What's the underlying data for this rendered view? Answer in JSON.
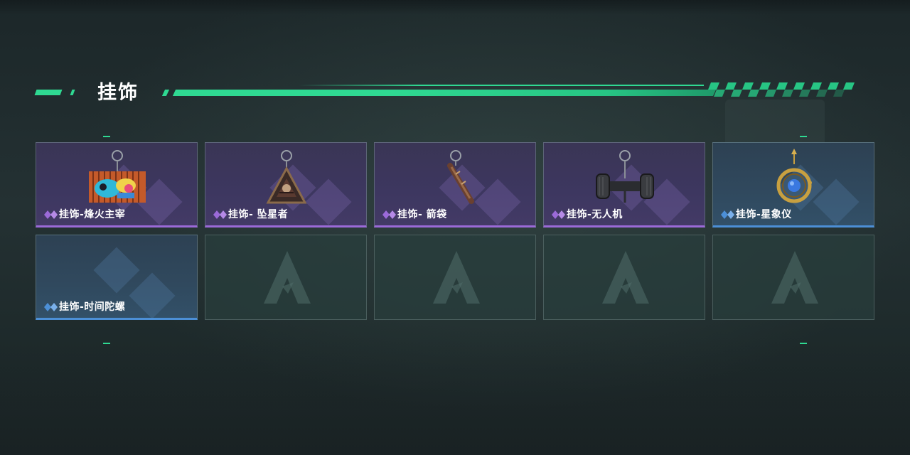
{
  "header": {
    "title": "挂饰"
  },
  "colors": {
    "accent_green": "#2fd992",
    "rarity_epic": "#9b6ad8",
    "rarity_rare": "#4c8fd6"
  },
  "items": [
    {
      "label": "挂饰-烽火主宰",
      "rarity": "epic",
      "icon": "graffiti-container-charm-icon"
    },
    {
      "label": "挂饰- 坠星者",
      "rarity": "epic",
      "icon": "triangle-pendant-charm-icon"
    },
    {
      "label": "挂饰- 箭袋",
      "rarity": "epic",
      "icon": "quiver-charm-icon"
    },
    {
      "label": "挂饰-无人机",
      "rarity": "epic",
      "icon": "drone-charm-icon"
    },
    {
      "label": "挂饰-星象仪",
      "rarity": "rare",
      "icon": "astrolabe-charm-icon"
    },
    {
      "label": "挂饰-时间陀螺",
      "rarity": "rare",
      "icon": "time-gyro-charm-icon"
    }
  ],
  "empty_slots": 4
}
